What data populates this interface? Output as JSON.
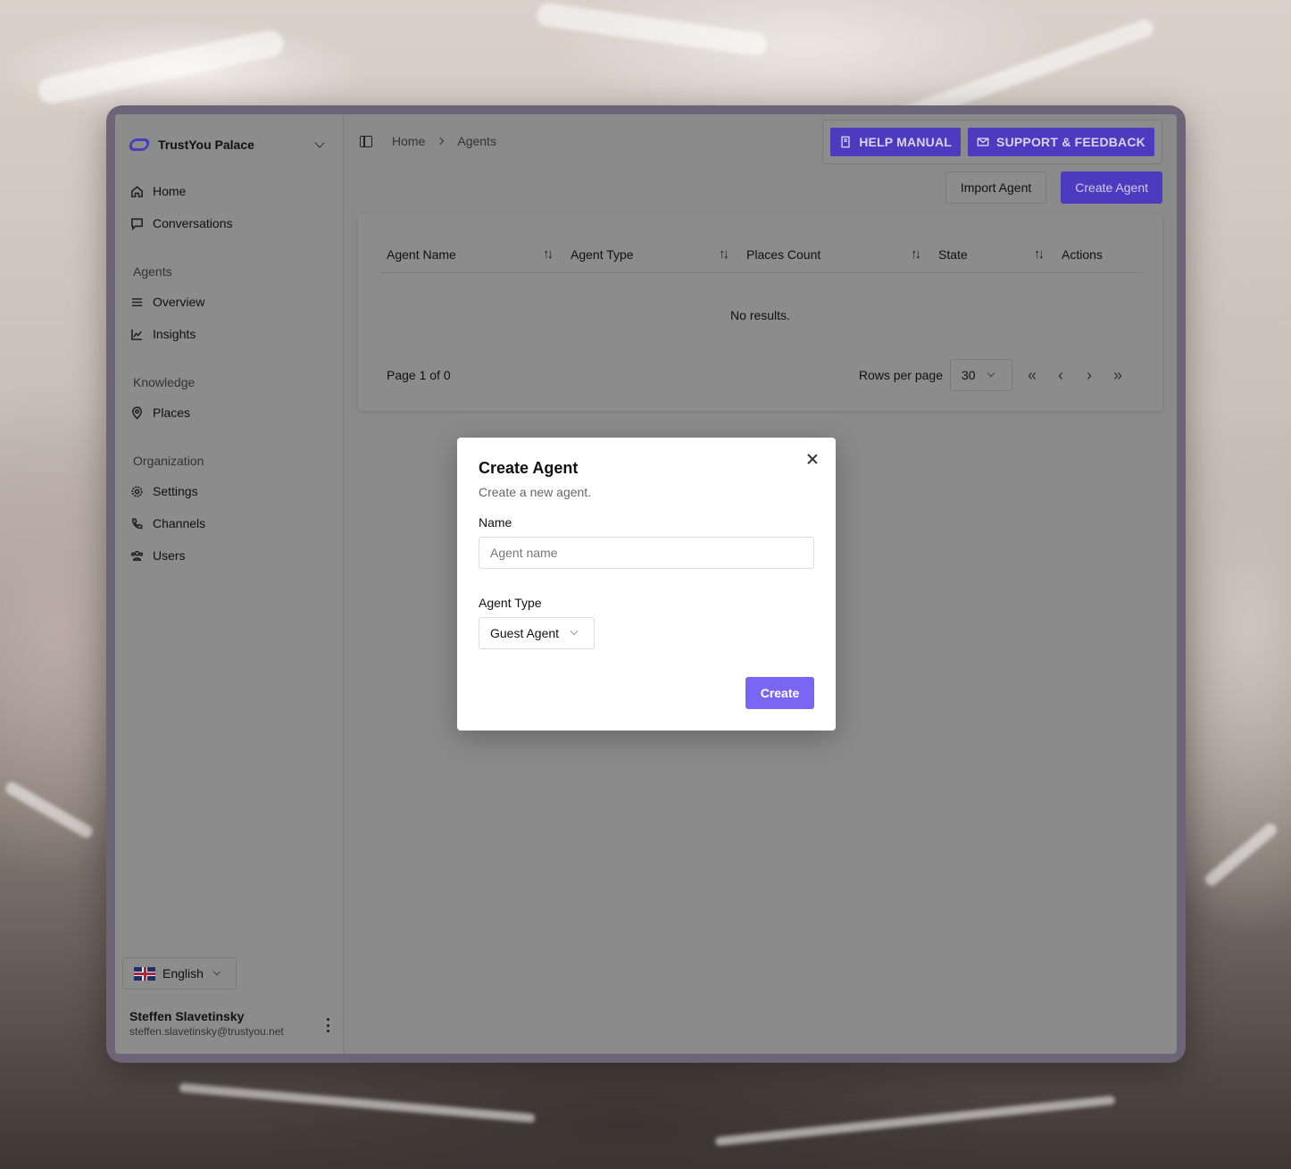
{
  "org": {
    "name": "TrustYou Palace"
  },
  "nav": {
    "home": "Home",
    "conversations": "Conversations",
    "agents_section": "Agents",
    "overview": "Overview",
    "insights": "Insights",
    "knowledge_section": "Knowledge",
    "places": "Places",
    "organization_section": "Organization",
    "settings": "Settings",
    "channels": "Channels",
    "users": "Users"
  },
  "language": {
    "selected": "English"
  },
  "user": {
    "name": "Steffen Slavetinsky",
    "email": "steffen.slavetinsky@trustyou.net"
  },
  "breadcrumb": {
    "home": "Home",
    "current": "Agents"
  },
  "header": {
    "help_manual": "HELP MANUAL",
    "support_feedback": "SUPPORT & FEEDBACK"
  },
  "toolbar": {
    "import_agent": "Import Agent",
    "create_agent": "Create Agent"
  },
  "table": {
    "columns": [
      "Agent Name",
      "Agent Type",
      "Places Count",
      "State",
      "Actions"
    ],
    "empty_text": "No results."
  },
  "pagination": {
    "page_info": "Page 1 of 0",
    "rows_label": "Rows per page",
    "rows_value": "30"
  },
  "modal": {
    "title": "Create Agent",
    "description": "Create a new agent.",
    "name_label": "Name",
    "name_placeholder": "Agent name",
    "type_label": "Agent Type",
    "type_value": "Guest Agent",
    "submit": "Create"
  },
  "colors": {
    "brand": "#4d3bbf",
    "modal_primary": "#7a66f2"
  }
}
